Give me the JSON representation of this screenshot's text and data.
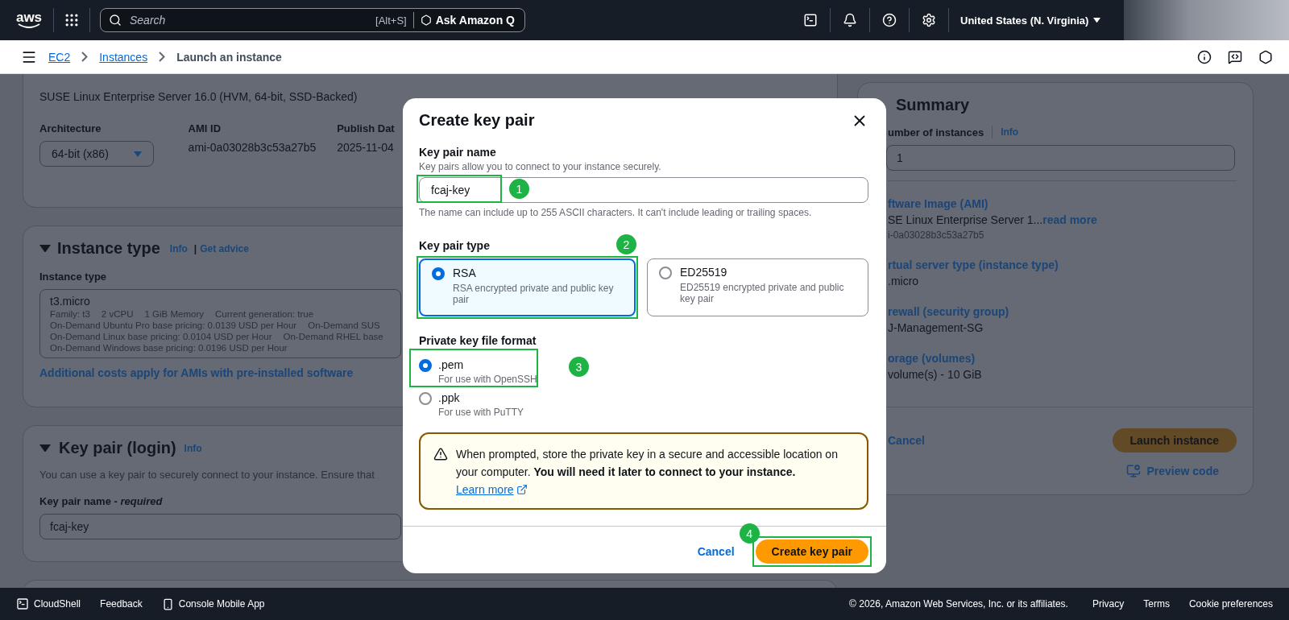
{
  "top_nav": {
    "logo": "aws",
    "search": {
      "placeholder": "Search",
      "shortcut": "[Alt+S]"
    },
    "assistant_button": "Ask Amazon Q",
    "region": "United States (N. Virginia)"
  },
  "breadcrumb": [
    {
      "label": "EC2",
      "link": true
    },
    {
      "label": "Instances",
      "link": true
    },
    {
      "label": "Launch an instance",
      "link": false
    }
  ],
  "ami_card": {
    "name": "SUSE Linux Enterprise Server 16.0 (HVM, 64-bit, SSD-Backed)",
    "fields": [
      {
        "kind": "select",
        "label": "Architecture",
        "value": "64-bit (x86)"
      },
      {
        "kind": "text",
        "label": "AMI ID",
        "value": "ami-0a03028b3c53a27b5"
      },
      {
        "kind": "text",
        "label": "Publish Dat",
        "value": "2025-11-04"
      }
    ]
  },
  "instance_type": {
    "title": "Instance type",
    "info": "Info",
    "separator": "|",
    "advice": "Get advice",
    "field_label": "Instance type",
    "value": "t3.micro",
    "details": [
      {
        "items": [
          "Family: t3",
          "2 vCPU",
          "1 GiB Memory",
          "Current generation: true"
        ]
      },
      {
        "items": [
          "On-Demand Ubuntu Pro base pricing: 0.0139 USD per Hour",
          "On-Demand SUS"
        ]
      },
      {
        "items": [
          "On-Demand Linux base pricing: 0.0104 USD per Hour",
          "On-Demand RHEL base"
        ]
      },
      {
        "items": [
          "On-Demand Windows base pricing: 0.0196 USD per Hour"
        ]
      }
    ],
    "note_link": "Additional costs apply for AMIs with pre-installed software"
  },
  "key_pair": {
    "title": "Key pair (login)",
    "info": "Info",
    "description": "You can use a key pair to securely connect to your instance. Ensure that",
    "field_label": "Key pair name - *required*",
    "value": "fcaj-key"
  },
  "summary": {
    "title": "Summary",
    "count_label": "umber of instances",
    "count_info": "Info",
    "count_value": "1",
    "items": [
      {
        "label": "ftware Image (AMI)",
        "value": "SE Linux Enterprise Server 1...",
        "link": "read more",
        "sub": "i-0a03028b3c53a27b5"
      },
      {
        "label": "rtual server type (instance type)",
        "value": ".micro"
      },
      {
        "label": "rewall (security group)",
        "value": "J-Management-SG"
      },
      {
        "label": "orage (volumes)",
        "value": "volume(s) - 10 GiB"
      }
    ],
    "cancel": "Cancel",
    "launch": "Launch instance",
    "preview": "Preview code"
  },
  "modal": {
    "title": "Create key pair",
    "name_field": {
      "label": "Key pair name",
      "description": "Key pairs allow you to connect to your instance securely.",
      "value": "fcaj-key",
      "hint": "The name can include up to 255 ASCII characters. It can't include leading or trailing spaces."
    },
    "key_type": {
      "label": "Key pair type",
      "options": [
        {
          "title": "RSA",
          "description": "RSA encrypted private and public key pair",
          "selected": true
        },
        {
          "title": "ED25519",
          "description": "ED25519 encrypted private and public key pair",
          "selected": false
        }
      ]
    },
    "file_format": {
      "label": "Private key file format",
      "options": [
        {
          "title": ".pem",
          "description": "For use with OpenSSH",
          "selected": true
        },
        {
          "title": ".ppk",
          "description": "For use with PuTTY",
          "selected": false
        }
      ]
    },
    "alert": {
      "text": "When prompted, store the private key in a secure and accessible location on your computer. **You will need it later to connect to your instance.**",
      "link": "Learn more"
    },
    "cancel": "Cancel",
    "submit": "Create key pair"
  },
  "annotations": [
    {
      "number": "1"
    },
    {
      "number": "2"
    },
    {
      "number": "3"
    },
    {
      "number": "4"
    }
  ],
  "footer": {
    "links": [
      {
        "label": "CloudShell",
        "kind": "shell"
      },
      {
        "label": "Feedback",
        "kind": "plain"
      },
      {
        "label": "Console Mobile App",
        "kind": "app"
      }
    ],
    "copyright": "© 2026, Amazon Web Services, Inc. or its affiliates.",
    "legal": [
      "Privacy",
      "Terms",
      "Cookie preferences"
    ]
  }
}
